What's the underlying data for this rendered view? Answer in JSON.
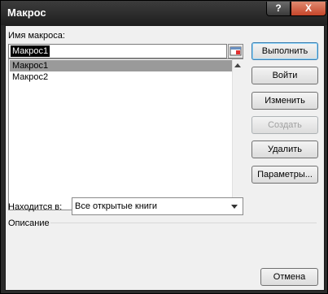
{
  "window": {
    "title": "Макрос",
    "help_label": "?",
    "close_label": "X"
  },
  "macro_name": {
    "label": "Имя макроса:",
    "value": "Макрос1"
  },
  "macro_list": {
    "items": [
      "Макрос1",
      "Макрос2"
    ],
    "selected_index": 0
  },
  "buttons": {
    "run": "Выполнить",
    "step_into": "Войти",
    "edit": "Изменить",
    "create": "Создать",
    "delete": "Удалить",
    "options": "Параметры...",
    "cancel": "Отмена"
  },
  "location": {
    "label": "Находится в:",
    "selected": "Все открытые книги"
  },
  "description": {
    "label": "Описание"
  },
  "icons": {
    "ref": "range-selector-icon",
    "scroll_up": "arrow-up-icon",
    "scroll_down": "arrow-down-icon",
    "dropdown": "chevron-down-icon"
  }
}
